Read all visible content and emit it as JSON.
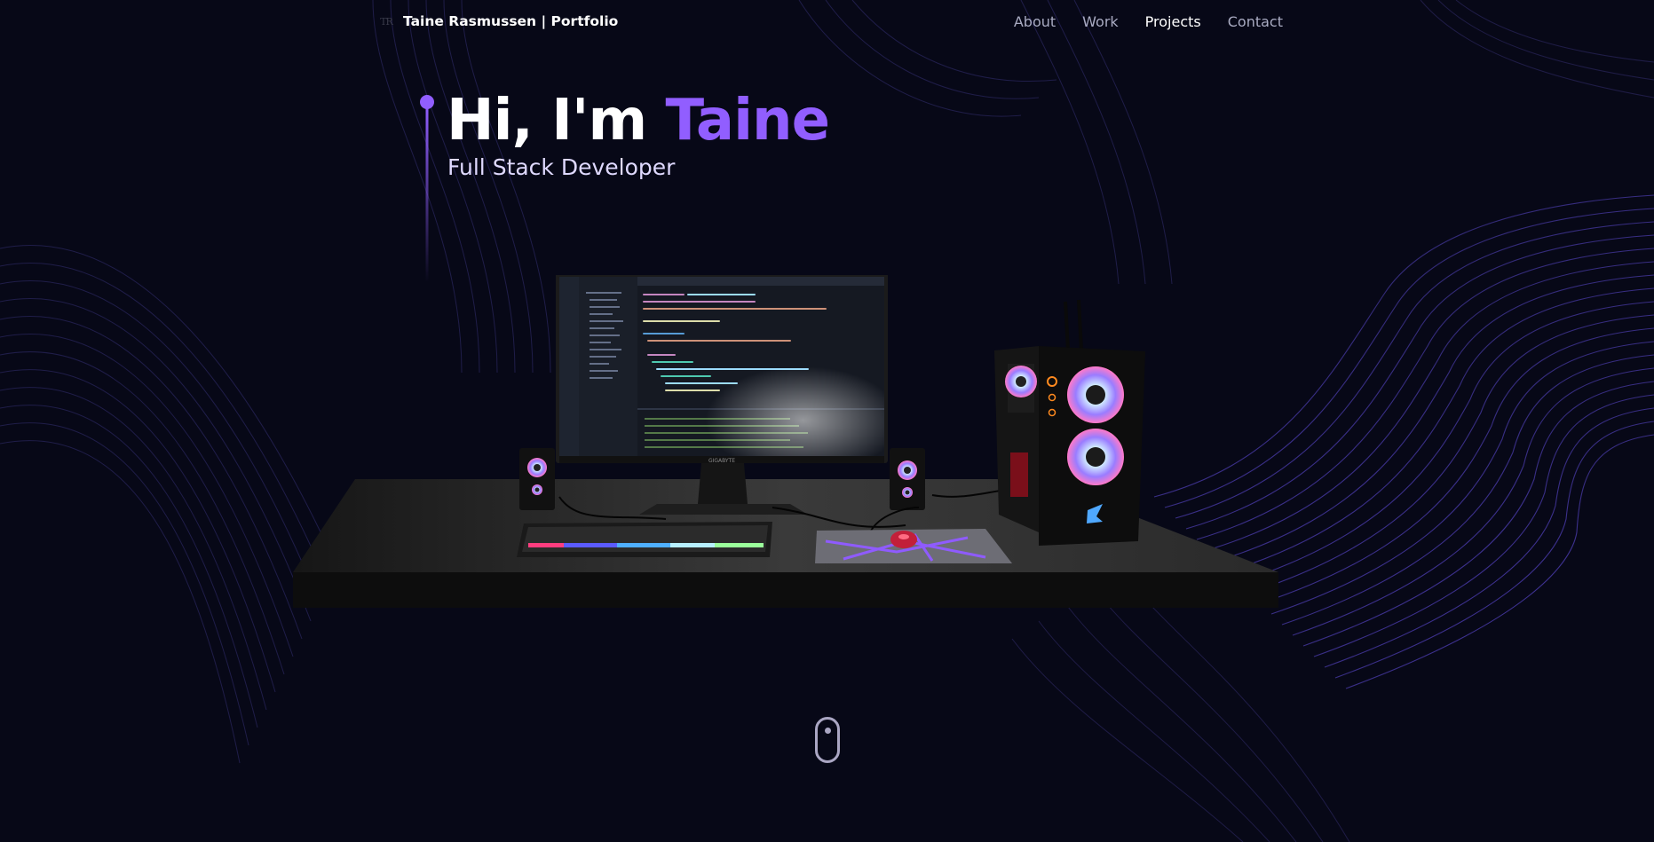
{
  "header": {
    "logo_mark": "TR",
    "logo_text": "Taine Rasmussen | Portfolio",
    "nav": [
      {
        "label": "About"
      },
      {
        "label": "Work"
      },
      {
        "label": "Projects"
      },
      {
        "label": "Contact"
      }
    ]
  },
  "hero": {
    "greeting": "Hi, I'm ",
    "name": "Taine",
    "subtitle": "Full Stack Developer"
  },
  "scene": {
    "monitor_brand": "GIGABYTE"
  },
  "colors": {
    "background": "#070817",
    "accent": "#915eff",
    "wave": "#4b3fb0"
  }
}
